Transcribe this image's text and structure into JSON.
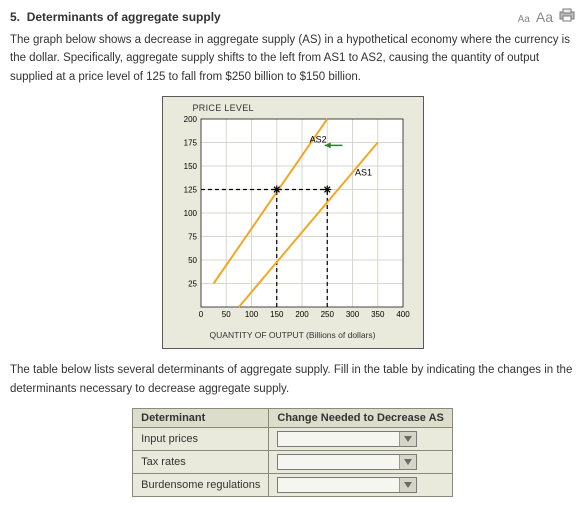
{
  "header": {
    "number": "5.",
    "title": "Determinants of aggregate supply",
    "aa_small": "Aa",
    "aa_large": "Aa"
  },
  "paragraph1": "The graph below shows a decrease in aggregate supply (AS) in a hypothetical economy where the currency is the dollar. Specifically, aggregate supply shifts to the left from AS1 to AS2, causing the quantity of output supplied at a price level of 125 to fall from $250 billion to $150 billion.",
  "paragraph2": "The table below lists several determinants of aggregate supply. Fill in the table by indicating the changes in the determinants necessary to decrease aggregate supply.",
  "chart_data": {
    "type": "line",
    "title": "PRICE LEVEL",
    "xlabel": "QUANTITY OF OUTPUT (Billions of dollars)",
    "ylabel": "",
    "xlim": [
      0,
      400
    ],
    "ylim": [
      0,
      200
    ],
    "x_ticks": [
      0,
      50,
      100,
      150,
      200,
      250,
      300,
      350,
      400
    ],
    "y_ticks": [
      25,
      50,
      75,
      100,
      125,
      150,
      175,
      200
    ],
    "series": [
      {
        "name": "AS1",
        "x": [
          75,
          350
        ],
        "y": [
          0,
          175
        ],
        "color": "#f5a623"
      },
      {
        "name": "AS2",
        "x": [
          25,
          250
        ],
        "y": [
          25,
          200
        ],
        "color": "#f5a623"
      }
    ],
    "markers": [
      {
        "x": 150,
        "y": 125
      },
      {
        "x": 250,
        "y": 125
      }
    ],
    "guide_lines": [
      {
        "from": {
          "x": 0,
          "y": 125
        },
        "to": {
          "x": 250,
          "y": 125
        }
      },
      {
        "from": {
          "x": 150,
          "y": 0
        },
        "to": {
          "x": 150,
          "y": 125
        }
      },
      {
        "from": {
          "x": 250,
          "y": 0
        },
        "to": {
          "x": 250,
          "y": 125
        }
      }
    ],
    "annotations": [
      {
        "text": "AS2",
        "x": 215,
        "y": 175
      },
      {
        "text": "AS1",
        "x": 305,
        "y": 140
      }
    ],
    "arrow": {
      "from": {
        "x": 280,
        "y": 172
      },
      "to": {
        "x": 245,
        "y": 172
      }
    }
  },
  "table": {
    "headers": {
      "det": "Determinant",
      "change": "Change Needed to Decrease AS"
    },
    "rows": [
      {
        "det": "Input prices",
        "value": ""
      },
      {
        "det": "Tax rates",
        "value": ""
      },
      {
        "det": "Burdensome regulations",
        "value": ""
      }
    ]
  }
}
